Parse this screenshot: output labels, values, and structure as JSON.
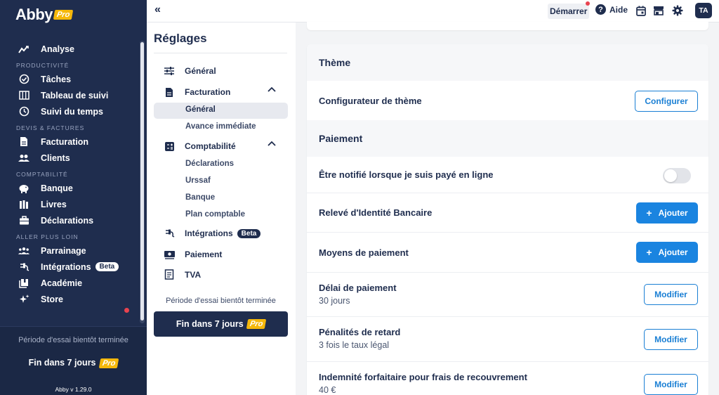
{
  "app": {
    "logo_text": "Abby",
    "logo_badge": "Pro",
    "version": "Abby v 1.29.0"
  },
  "sidebar": {
    "analyse": "Analyse",
    "sections": {
      "productivite": "PRODUCTIVITÉ",
      "devis": "DEVIS & FACTURES",
      "comptabilite": "COMPTABILITÉ",
      "aller": "ALLER PLUS LOIN"
    },
    "items": {
      "taches": "Tâches",
      "tableau": "Tableau de suivi",
      "suivi": "Suivi du temps",
      "facturation": "Facturation",
      "clients": "Clients",
      "banque": "Banque",
      "livres": "Livres",
      "declarations": "Déclarations",
      "parrainage": "Parrainage",
      "integrations": "Intégrations",
      "integrations_badge": "Beta",
      "academie": "Académie",
      "store": "Store"
    },
    "trial_text": "Période d'essai bientôt terminée",
    "trial_cta": "Fin dans 7 jours",
    "trial_badge": "Pro"
  },
  "subnav": {
    "title": "Réglages",
    "general": "Général",
    "facturation": "Facturation",
    "facturation_children": {
      "general": "Général",
      "avance": "Avance immédiate"
    },
    "comptabilite": "Comptabilité",
    "comptabilite_children": {
      "declarations": "Déclarations",
      "urssaf": "Urssaf",
      "banque": "Banque",
      "plan": "Plan comptable"
    },
    "integrations": "Intégrations",
    "integrations_badge": "Beta",
    "paiement": "Paiement",
    "tva": "TVA",
    "trial_text": "Période d'essai bientôt terminée",
    "trial_cta": "Fin dans 7 jours",
    "trial_badge": "Pro"
  },
  "topbar": {
    "demarrer": "Démarrer",
    "aide": "Aide",
    "avatar": "TA"
  },
  "main": {
    "theme": {
      "heading": "Thème",
      "configurateur_label": "Configurateur de thème",
      "configurer_btn": "Configurer"
    },
    "paiement": {
      "heading": "Paiement",
      "notif_label": "Être notifié lorsque je suis payé en ligne",
      "notif_enabled": false,
      "rib_label": "Relevé d'Identité Bancaire",
      "rib_btn": "Ajouter",
      "moyens_label": "Moyens de paiement",
      "moyens_btn": "Ajouter",
      "delai_label": "Délai de paiement",
      "delai_value": "30 jours",
      "delai_btn": "Modifier",
      "penalites_label": "Pénalités de retard",
      "penalites_value": "3 fois le taux légal",
      "penalites_btn": "Modifier",
      "indemnite_label": "Indemnité forfaitaire pour frais de recouvrement",
      "indemnite_value": "40 €",
      "indemnite_btn": "Modifier"
    }
  },
  "colors": {
    "navy": "#1f2d4e",
    "accent_blue": "#1a84e0",
    "pro_yellow": "#f5b80b",
    "alert_red": "#e8434f"
  }
}
